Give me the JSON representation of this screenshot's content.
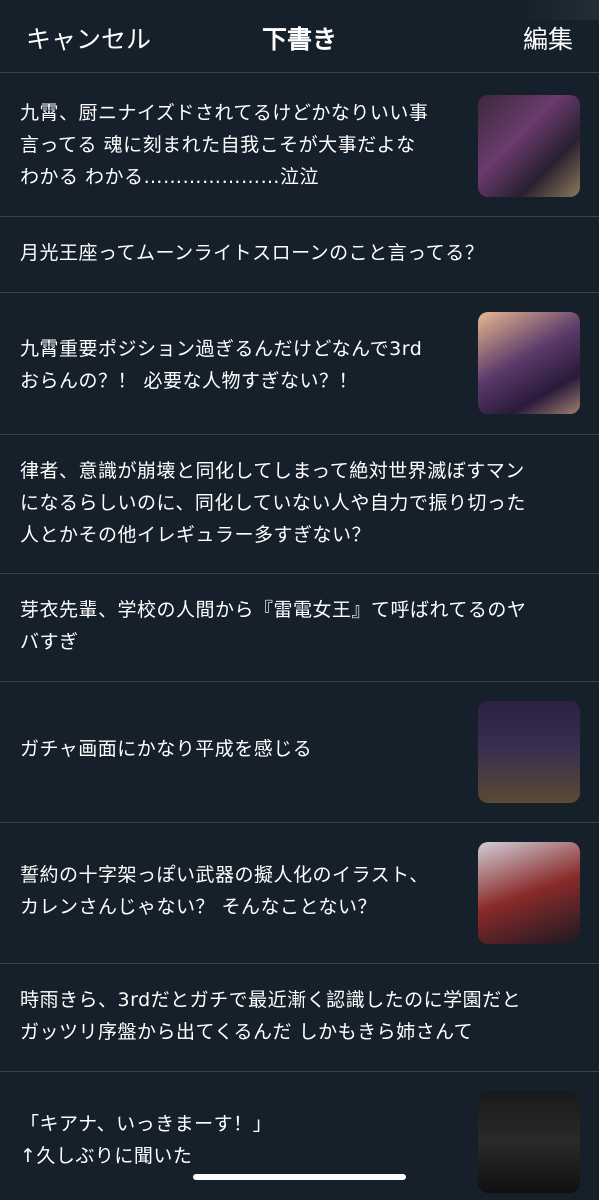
{
  "header": {
    "cancel": "キャンセル",
    "title": "下書き",
    "edit": "編集"
  },
  "drafts": [
    {
      "text": "九霄、厨ニナイズドされてるけどかなりいい事\n言ってる 魂に刻まれた自我こそが大事だよな\nわかる わかる…………………泣泣",
      "image": "game-screenshot-thumbnail"
    },
    {
      "text": "月光王座ってムーンライトスローンのこと言ってる？"
    },
    {
      "text": "九霄重要ポジション過ぎるんだけどなんで3rd\nおらんの？！ 必要な人物すぎない？！",
      "image": "game-screenshot-thumbnail"
    },
    {
      "text": "律者、意識が崩壊と同化してしまって絶対世界滅ぼすマン\nになるらしいのに、同化していない人や自力で振り切った\n人とかその他イレギュラー多すぎない？"
    },
    {
      "text": "芽衣先輩、学校の人間から『雷電女王』て呼ばれてるのヤ\nバすぎ"
    },
    {
      "text": "ガチャ画面にかなり平成を感じる",
      "image": "gacha-screenshot-thumbnail"
    },
    {
      "text": "誓約の十字架っぽい武器の擬人化のイラスト、\nカレンさんじゃない？ そんなことない？",
      "image": "illustration-thumbnail"
    },
    {
      "text": "時雨きら、3rdだとガチで最近漸く認識したのに学園だと\nガッツリ序盤から出てくるんだ しかもきら姉さんて"
    },
    {
      "text": "「キアナ、いっきまーす！」\n↑久しぶりに聞いた",
      "image": "character-screenshot-thumbnail"
    }
  ]
}
